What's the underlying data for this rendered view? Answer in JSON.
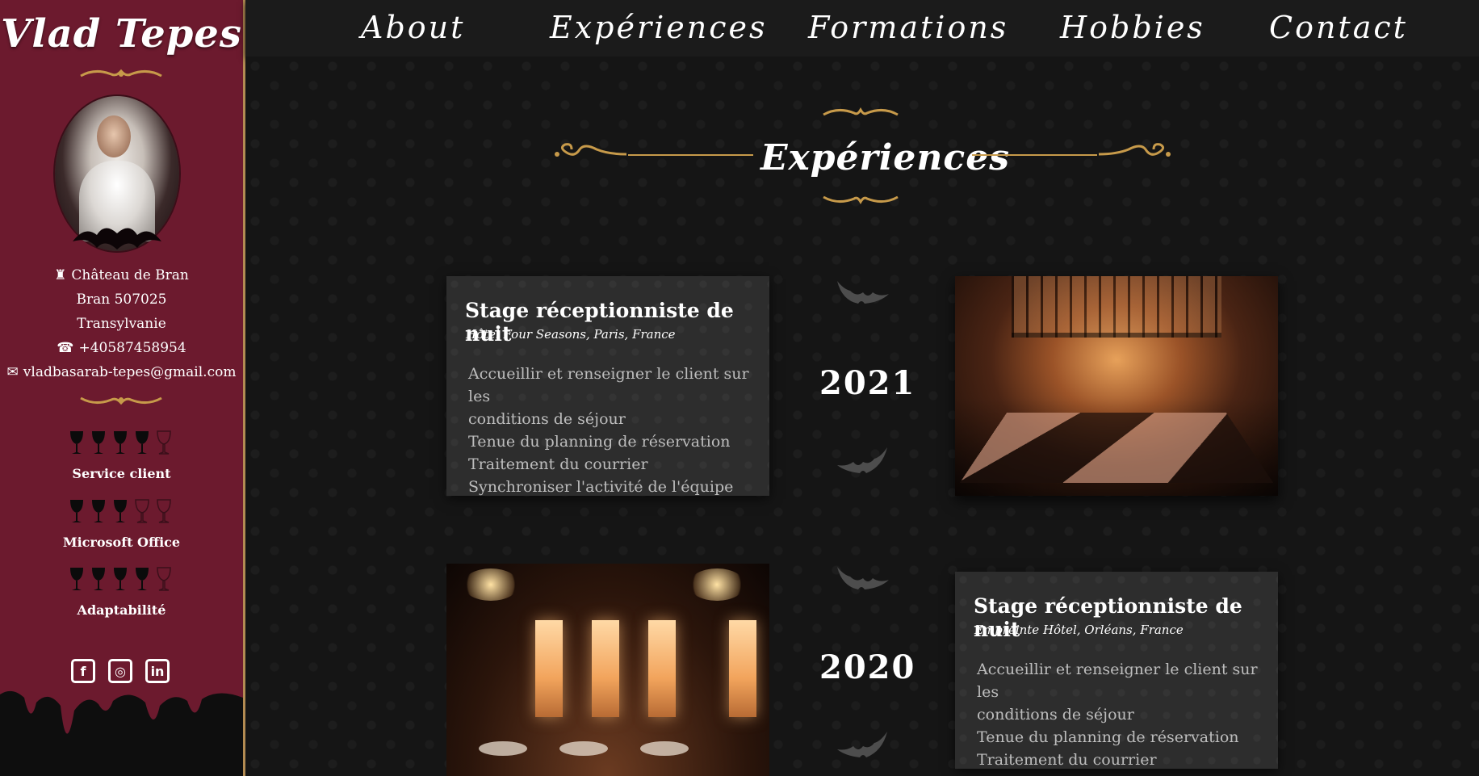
{
  "sidebar": {
    "name": "Vlad Tepes",
    "address": {
      "line1": "Château de Bran",
      "line2": "Bran 507025",
      "line3": "Transylvanie"
    },
    "phone": "+40587458954",
    "email": "vladbasarab-tepes@gmail.com",
    "skills": [
      {
        "label": "Service client",
        "level": 4,
        "max": 5
      },
      {
        "label": "Microsoft Office",
        "level": 3,
        "max": 5
      },
      {
        "label": "Adaptabilité",
        "level": 4,
        "max": 5
      }
    ],
    "socials": [
      {
        "icon": "facebook-icon",
        "glyph": "f"
      },
      {
        "icon": "instagram-icon",
        "glyph": "◎"
      },
      {
        "icon": "linkedin-icon",
        "glyph": "in"
      }
    ]
  },
  "nav": {
    "items": [
      "About",
      "Expériences",
      "Formations",
      "Hobbies",
      "Contact"
    ]
  },
  "main": {
    "section_title": "Expériences",
    "experiences": [
      {
        "year": "2021",
        "title": "Stage réceptionniste de nuit",
        "subtitle": "Hôtel Four Seasons, Paris, France",
        "tasks": [
          "Accueillir et renseigner le client sur les",
          "conditions de séjour",
          "Tenue du planning de réservation",
          "Traitement du courrier",
          "Synchroniser l'activité de l'équipe"
        ]
      },
      {
        "year": "2020",
        "title": "Stage réceptionniste de nuit",
        "subtitle": "Empreinte Hôtel, Orléans, France",
        "tasks": [
          "Accueillir et renseigner le client sur les",
          "conditions de séjour",
          "Tenue du planning de réservation",
          "Traitement du courrier"
        ]
      }
    ]
  },
  "colors": {
    "sidebar_bg": "#6c1a2e",
    "gold": "#c79a4a",
    "page_bg": "#151515",
    "card_bg": "#2d2d2d"
  }
}
